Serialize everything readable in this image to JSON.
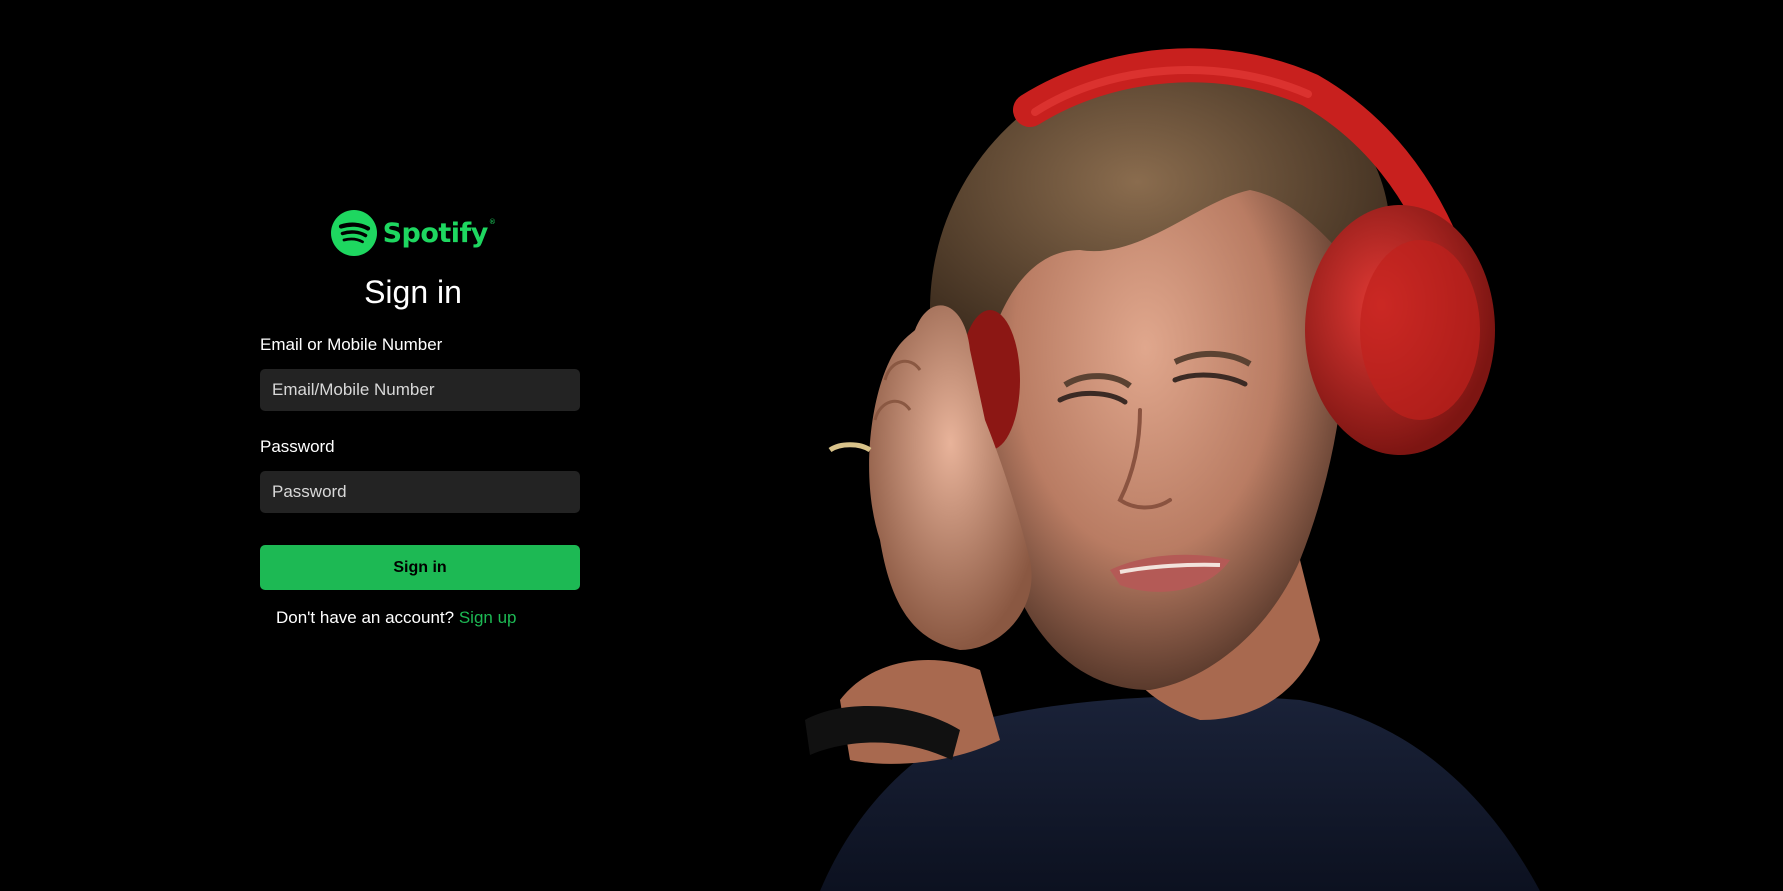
{
  "brand": {
    "name": "Spotify",
    "trademark": "®",
    "icon": "spotify-logo-icon",
    "color": "#1ed760"
  },
  "form": {
    "heading": "Sign in",
    "email_label": "Email or Mobile Number",
    "email_placeholder": "Email/Mobile Number",
    "email_value": "",
    "password_label": "Password",
    "password_placeholder": "Password",
    "password_value": "",
    "submit_label": "Sign in",
    "submit_color": "#1db954"
  },
  "signup": {
    "prompt": "Don't have an account?",
    "link_label": "Sign up"
  },
  "hero": {
    "image": "woman-with-red-headphones-photo"
  },
  "colors": {
    "background": "#000000",
    "input_background": "#232323",
    "accent": "#1db954"
  }
}
